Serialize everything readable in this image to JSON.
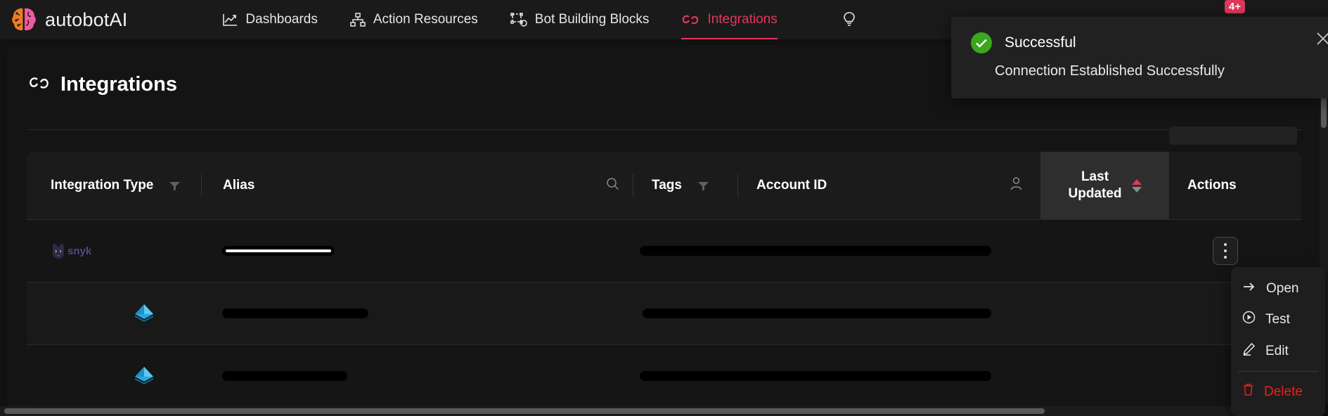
{
  "brand": {
    "name": "autobotAI",
    "logo_icon": "brain-logo-icon"
  },
  "nav": {
    "items": [
      {
        "label": "Dashboards",
        "icon": "chart-line-icon",
        "active": false
      },
      {
        "label": "Action Resources",
        "icon": "sitemap-icon",
        "active": false
      },
      {
        "label": "Bot Building Blocks",
        "icon": "bot-blocks-icon",
        "active": false
      },
      {
        "label": "Integrations",
        "icon": "link-chain-icon",
        "active": true
      }
    ],
    "lightbulb_icon": "lightbulb-icon",
    "notification_badge": "4+"
  },
  "header": {
    "title": "Integrations",
    "icon": "link-chain-icon"
  },
  "table": {
    "columns": [
      {
        "key": "integration_type",
        "label": "Integration Type",
        "filter_icon": "filter-funnel-icon"
      },
      {
        "key": "alias",
        "label": "Alias"
      },
      {
        "key": "search",
        "label": "",
        "icon": "search-icon"
      },
      {
        "key": "tags",
        "label": "Tags",
        "filter_icon": "filter-funnel-icon"
      },
      {
        "key": "account_id",
        "label": "Account ID"
      },
      {
        "key": "person",
        "label": "",
        "icon": "user-icon"
      },
      {
        "key": "last_updated",
        "label": "Last\nUpdated",
        "sort_icon": "sort-arrows-icon",
        "sort_active": "asc"
      },
      {
        "key": "actions",
        "label": "Actions"
      }
    ],
    "rows": [
      {
        "integration_type": "snyk",
        "type_icon": "snyk-logo-icon",
        "alias": "",
        "alias_redacted": true,
        "tags": "",
        "account_id": "",
        "account_redacted": true,
        "last_updated": "",
        "actions_icon": "kebab-menu-icon"
      },
      {
        "integration_type": "",
        "type_icon": "azure-pyramid-icon",
        "alias": "",
        "alias_redacted": true,
        "tags": "",
        "account_id": "",
        "account_redacted": true,
        "last_updated": "",
        "actions_icon": "kebab-menu-icon"
      },
      {
        "integration_type": "",
        "type_icon": "azure-pyramid-icon",
        "alias": "",
        "alias_redacted": true,
        "tags": "",
        "account_id": "",
        "account_redacted": true,
        "last_updated": "",
        "actions_icon": "kebab-menu-icon"
      }
    ]
  },
  "action_menu": {
    "items": [
      {
        "label": "Open",
        "icon": "arrow-right-icon",
        "danger": false
      },
      {
        "label": "Test",
        "icon": "play-circle-icon",
        "danger": false
      },
      {
        "label": "Edit",
        "icon": "pencil-icon",
        "danger": false
      },
      {
        "label": "Delete",
        "icon": "trash-icon",
        "danger": true
      }
    ]
  },
  "toast": {
    "title": "Successful",
    "message": "Connection Established Successfully",
    "status_icon": "check-circle-icon",
    "close_icon": "close-icon"
  },
  "colors": {
    "accent": "#e0385c",
    "success": "#3aa71c",
    "danger": "#e62020",
    "background": "#111111",
    "surface": "#1b1b1b",
    "snyk_text": "#4b4f80"
  }
}
